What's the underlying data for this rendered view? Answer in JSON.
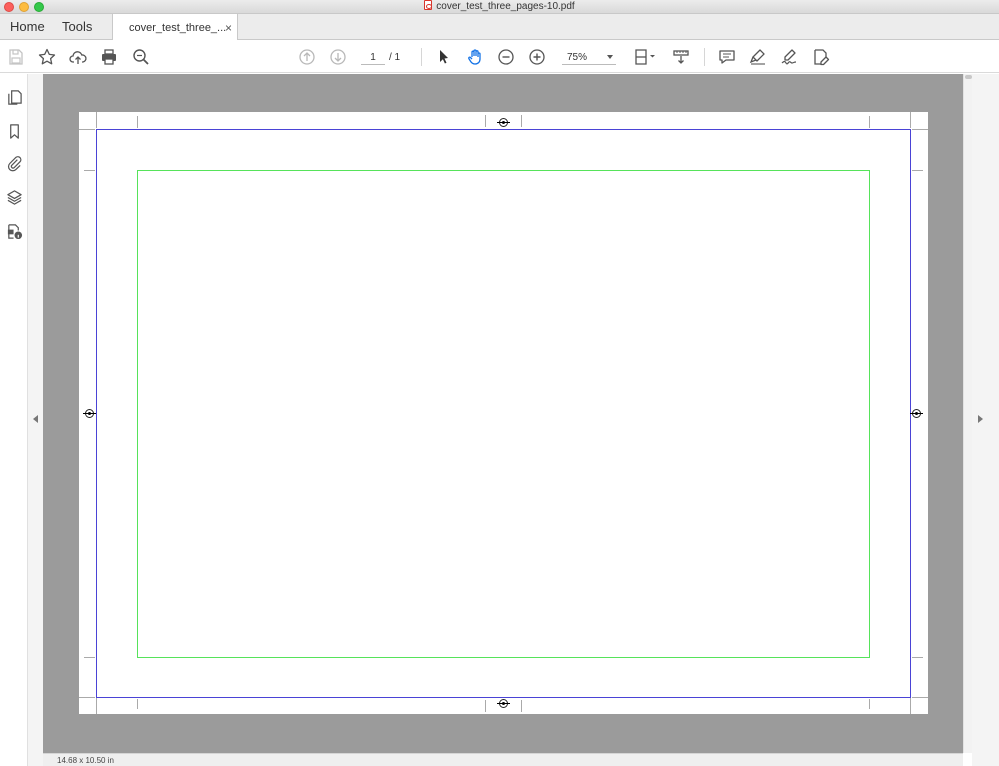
{
  "window": {
    "title": "cover_test_three_pages-10.pdf"
  },
  "nav": {
    "home_label": "Home",
    "tools_label": "Tools",
    "doc_tab_label": "cover_test_three_...",
    "doc_tab_close": "×"
  },
  "toolbar": {
    "current_page": "1",
    "page_total": "/ 1",
    "zoom_value": "75%",
    "icons": [
      "save-icon",
      "bookmark-star-icon",
      "cloud-upload-icon",
      "print-icon",
      "search-zoom-icon",
      "page-up-icon",
      "page-down-icon",
      "select-cursor-icon",
      "hand-tool-icon",
      "zoom-out-icon",
      "zoom-in-icon",
      "page-fit-icon",
      "scroll-mode-icon",
      "comment-icon",
      "highlight-icon",
      "sign-icon",
      "edit-pdf-icon"
    ],
    "active_tool": "hand-tool",
    "accent_color": "#1473e6"
  },
  "sidebar": {
    "icons": [
      "page-thumbnails-icon",
      "bookmarks-icon",
      "attachments-icon",
      "layers-icon",
      "security-info-icon"
    ]
  },
  "document": {
    "trim_box_color": "#4a43d6",
    "safe_area_color": "#56e35a",
    "background_color": "#9b9b9b"
  },
  "status": {
    "page_size": "14.68 x 10.50 in"
  }
}
